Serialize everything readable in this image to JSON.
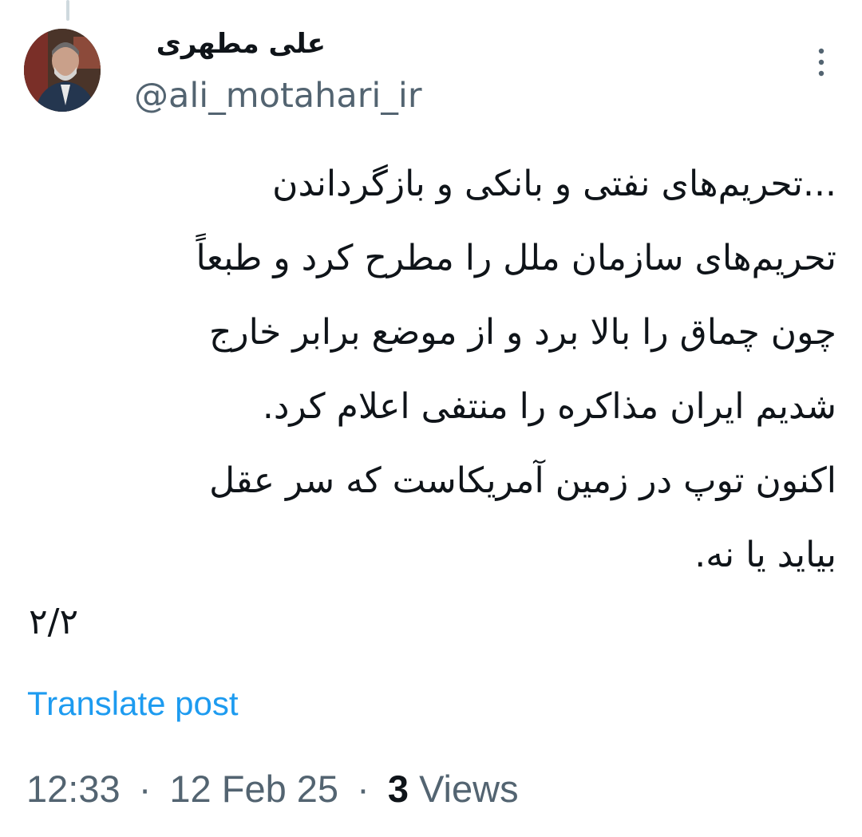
{
  "colors": {
    "text_primary": "#0f1419",
    "text_secondary": "#536471",
    "link": "#1d9bf0",
    "thread_line": "#cfd9de"
  },
  "author": {
    "display_name": "علی مطهری",
    "handle": "@ali_motahari_ir",
    "avatar_icon": "profile-photo"
  },
  "more_icon": "more-vertical-icon",
  "tweet": {
    "lines": [
      "...تحریم‌های نفتی و بانکی و بازگرداندن",
      "تحریم‌های سازمان ملل را مطرح کرد و طبعاً",
      "چون چماق را بالا برد و از موضع برابر خارج",
      "شدیم ایران مذاکره را منتفی اعلام کرد.",
      "اکنون توپ در زمین آمریکاست که سر عقل",
      "بیاید یا نه."
    ],
    "thread_count": "۲/۲"
  },
  "translate_label": "Translate post",
  "meta": {
    "time": "12:33",
    "separator": "·",
    "date": "12 Feb 25",
    "views_count": "3",
    "views_label": "Views"
  }
}
